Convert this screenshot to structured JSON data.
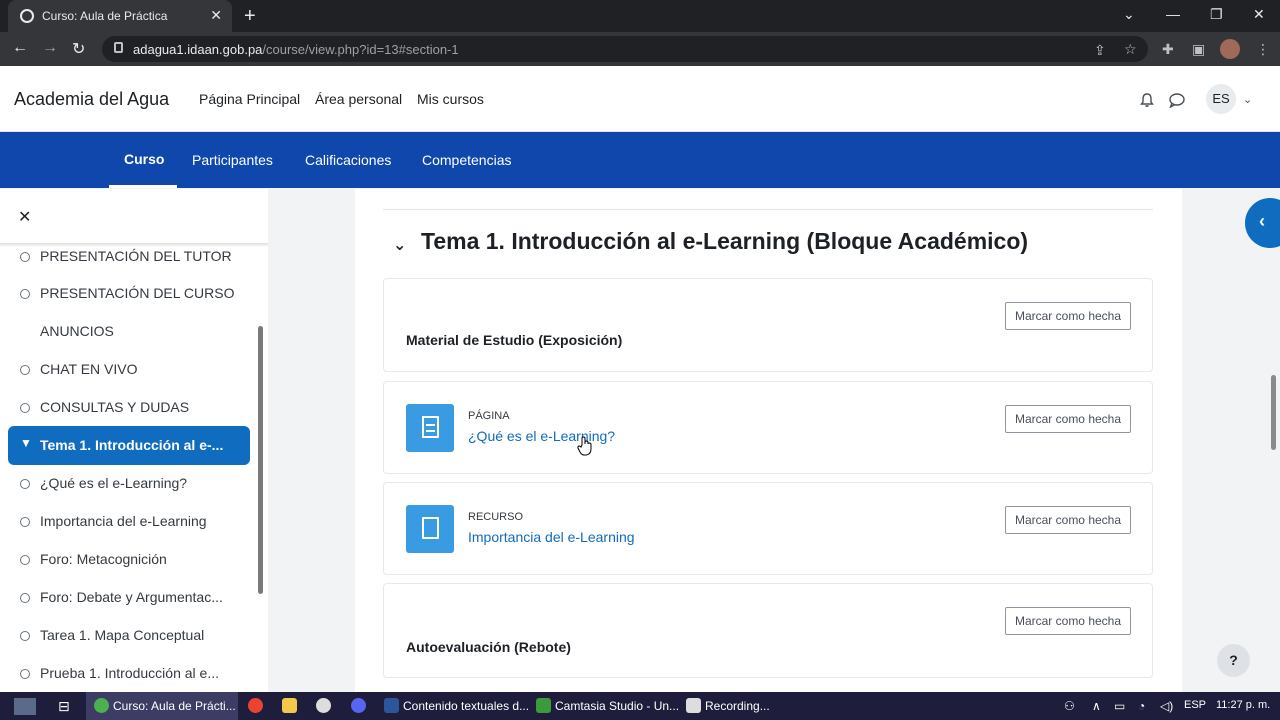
{
  "browser": {
    "tab_title": "Curso: Aula de Práctica",
    "tab_close": "✕",
    "new_tab": "+",
    "url_host": "adagua1.idaan.gob.pa",
    "url_path": "/course/view.php?id=13#section-1"
  },
  "site": {
    "brand": "Academia del Agua",
    "nav": [
      "Página Principal",
      "Área personal",
      "Mis cursos"
    ],
    "lang": "ES"
  },
  "course_nav": {
    "tabs": [
      "Curso",
      "Participantes",
      "Calificaciones",
      "Competencias"
    ],
    "active": "Curso"
  },
  "drawer": {
    "close_glyph": "✕",
    "items": [
      "PRESENTACIÓN DEL TUTOR",
      "PRESENTACIÓN DEL CURSO",
      "ANUNCIOS",
      "CHAT EN VIVO",
      "CONSULTAS Y DUDAS"
    ],
    "active_item": "Tema 1. Introducción al e-...",
    "sub_items": [
      "¿Qué es el e-Learning?",
      "Importancia del e-Learning",
      "Foro: Metacognición",
      "Foro: Debate y Argumentac...",
      "Tarea 1. Mapa Conceptual",
      "Prueba 1. Introducción al e..."
    ]
  },
  "main": {
    "section_title": "Tema 1. Introducción al e-Learning (Bloque Académico)",
    "mark_label": "Marcar como hecha",
    "cards": [
      {
        "title": "Material de Estudio (Exposición)"
      },
      {
        "kind": "PÁGINA",
        "link": "¿Qué es el e-Learning?"
      },
      {
        "kind": "RECURSO",
        "link": "Importancia del e-Learning"
      },
      {
        "title": "Autoevaluación (Rebote)"
      }
    ]
  },
  "help": "?",
  "taskbar": {
    "items": [
      "Curso: Aula de Prácti...",
      "Contenido textuales d...",
      "Camtasia Studio - Un...",
      "Recording..."
    ],
    "lang": "ESP",
    "clock": "11:27 p. m."
  },
  "colors": {
    "course_nav": "#0f47ad",
    "accent": "#0f6cbf",
    "activity_icon": "#399be2"
  }
}
